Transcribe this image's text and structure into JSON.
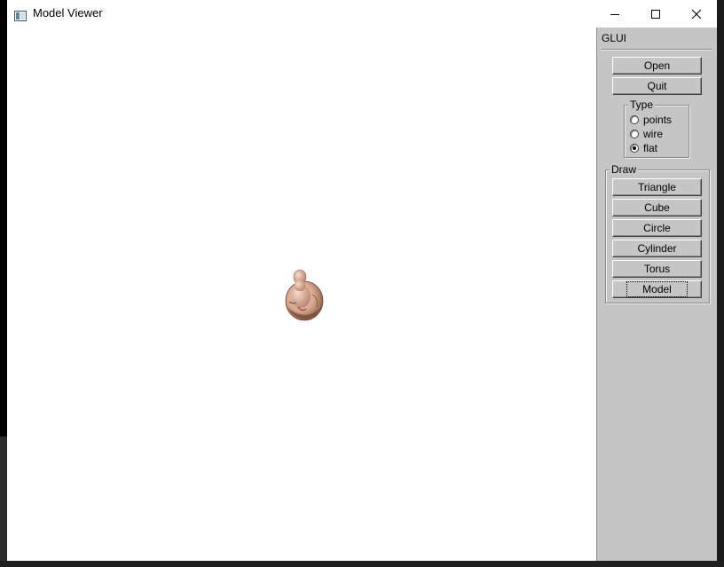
{
  "window": {
    "title": "Model Viewer",
    "icon": "window-app-icon",
    "controls": {
      "minimize": "minimize-icon",
      "maximize": "maximize-icon",
      "close": "close-icon"
    }
  },
  "canvas": {
    "background": "#ffffff",
    "model_color": "#d9a88e"
  },
  "glui": {
    "title": "GLUI",
    "buttons": {
      "open": "Open",
      "quit": "Quit"
    },
    "type_group": {
      "label": "Type",
      "options": [
        {
          "label": "points",
          "checked": false
        },
        {
          "label": "wire",
          "checked": false
        },
        {
          "label": "flat",
          "checked": true
        }
      ]
    },
    "draw_group": {
      "label": "Draw",
      "buttons": [
        "Triangle",
        "Cube",
        "Circle",
        "Cylinder",
        "Torus",
        "Model"
      ]
    }
  },
  "colors": {
    "panel": "#c5c5c5",
    "window": "#ffffff",
    "desktop": "#1a1a1a"
  }
}
